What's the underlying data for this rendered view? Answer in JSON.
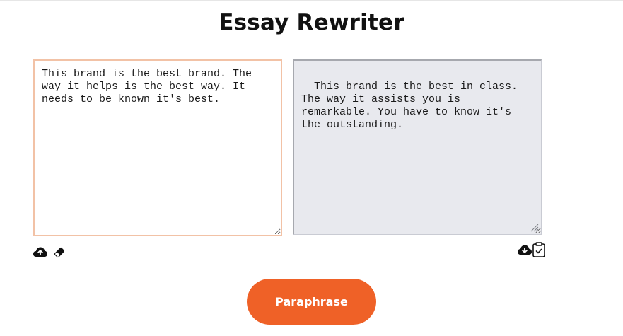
{
  "page": {
    "title": "Essay Rewriter"
  },
  "editor": {
    "input_text": "This brand is the best brand. The way it helps is the best way. It needs to be known it's best.",
    "output_text": "This brand is the best in class. The way it assists you is remarkable. You have to know it's the outstanding."
  },
  "input_toolbar": {
    "icons": [
      "cloud-upload-icon",
      "eraser-icon"
    ]
  },
  "output_toolbar": {
    "icons": [
      "cloud-download-icon",
      "clipboard-check-icon"
    ]
  },
  "action": {
    "paraphrase_label": "Paraphrase"
  },
  "colors": {
    "accent": "#ef6127",
    "input_border": "#f2c2a6",
    "output_background": "#e8e9ee",
    "text": "#111111"
  }
}
